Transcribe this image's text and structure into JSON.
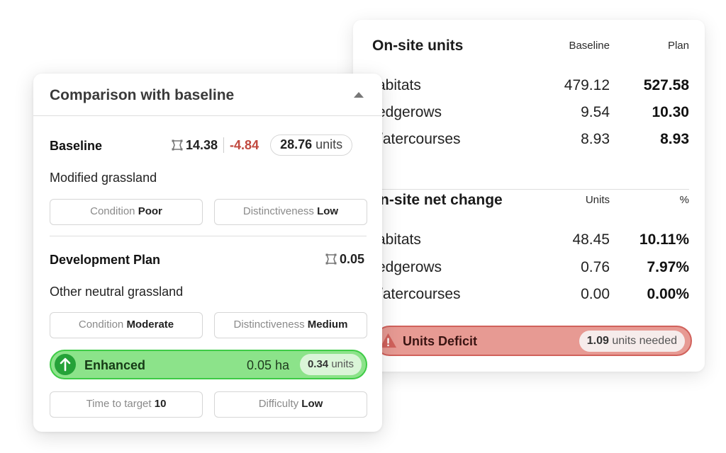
{
  "on_site_units": {
    "title": "On-site units",
    "col_baseline": "Baseline",
    "col_plan": "Plan",
    "rows": [
      {
        "label": "abitats",
        "baseline": "479.12",
        "plan": "527.58"
      },
      {
        "label": "edgerows",
        "baseline": "9.54",
        "plan": "10.30"
      },
      {
        "label": "/atercourses",
        "baseline": "8.93",
        "plan": "8.93"
      }
    ]
  },
  "net_change": {
    "title": "n-site net change",
    "col_units": "Units",
    "col_percent": "%",
    "rows": [
      {
        "label": "abitats",
        "units": "48.45",
        "percent": "10.11%"
      },
      {
        "label": "edgerows",
        "units": "0.76",
        "percent": "7.97%"
      },
      {
        "label": "/atercourses",
        "units": "0.00",
        "percent": "0.00%"
      }
    ]
  },
  "deficit": {
    "label": "Units Deficit",
    "needed_value": "1.09",
    "needed_suffix": "units needed",
    "icon": "warning-triangle-icon",
    "color": "#d1615b"
  },
  "comparison": {
    "title": "Comparison with baseline",
    "baseline": {
      "title": "Baseline",
      "area": "14.38",
      "change": "-4.84",
      "units_value": "28.76",
      "units_suffix": "units",
      "habitat": "Modified grassland",
      "condition_label": "Condition",
      "condition_value": "Poor",
      "distinctiveness_label": "Distinctiveness",
      "distinctiveness_value": "Low"
    },
    "plan": {
      "title": "Development Plan",
      "area": "0.05",
      "habitat": "Other neutral grassland",
      "condition_label": "Condition",
      "condition_value": "Moderate",
      "distinctiveness_label": "Distinctiveness",
      "distinctiveness_value": "Medium",
      "status": "Enhanced",
      "status_ha": "0.05 ha",
      "status_units_value": "0.34",
      "status_units_suffix": "units",
      "time_label": "Time to target",
      "time_value": "10",
      "difficulty_label": "Difficulty",
      "difficulty_value": "Low",
      "status_color": "#3ecb46"
    },
    "negative_color": "#c1493f"
  }
}
